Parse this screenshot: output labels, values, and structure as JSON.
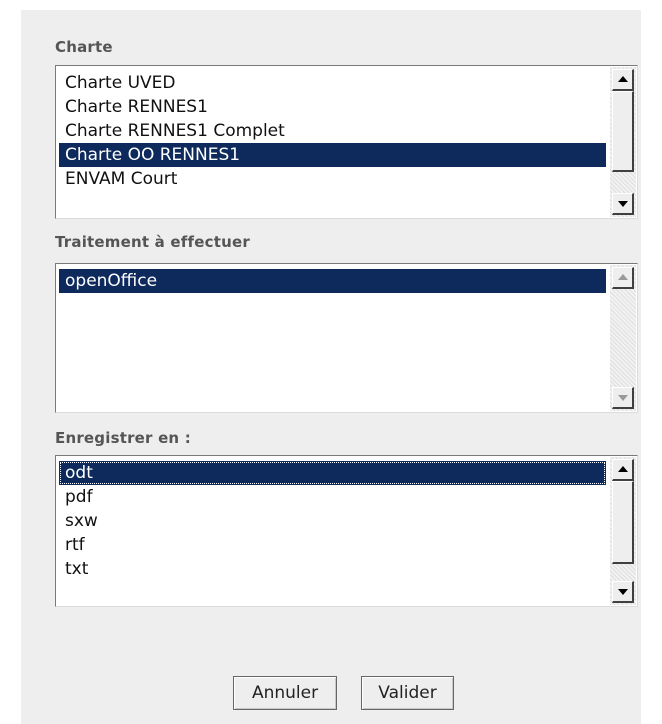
{
  "charte": {
    "label": "Charte",
    "items": [
      "Charte UVED",
      "Charte RENNES1",
      "Charte RENNES1 Complet",
      "Charte OO RENNES1",
      "ENVAM Court"
    ],
    "selected_index": 3
  },
  "traitement": {
    "label": "Traitement à effectuer",
    "items": [
      "openOffice"
    ],
    "selected_index": 0
  },
  "enregistrer": {
    "label": "Enregistrer en :",
    "items": [
      "odt",
      "pdf",
      "sxw",
      "rtf",
      "txt"
    ],
    "selected_index": 0
  },
  "buttons": {
    "cancel_label": "Annuler",
    "submit_label": "Valider"
  },
  "colors": {
    "panel_bg": "#eeeeee",
    "selection_bg": "#0e2a5c",
    "label_text": "#555555"
  }
}
